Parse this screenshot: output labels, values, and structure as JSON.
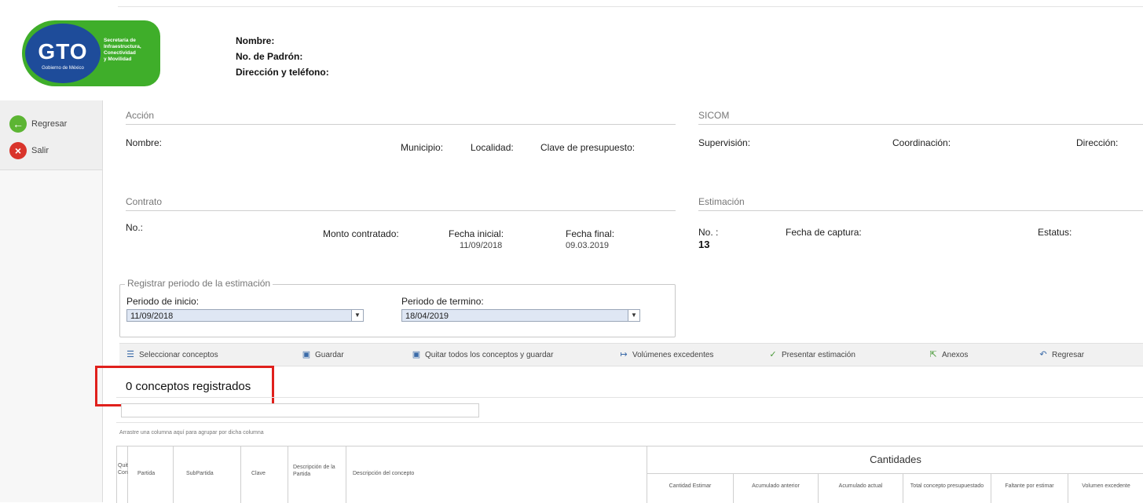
{
  "header": {
    "logo_text": "GTO",
    "logo_sub": "Gobierno de México",
    "logo_side": [
      "Secretaría de",
      "Infraestructura,",
      "Conectividad",
      "y Movilidad"
    ],
    "nombre_label": "Nombre:",
    "padron_label": "No. de Padrón:",
    "direccion_label": "Dirección y teléfono:"
  },
  "nav": {
    "regresar": "Regresar",
    "salir": "Salir"
  },
  "accion": {
    "title": "Acción",
    "nombre": "Nombre:",
    "municipio": "Municipio:",
    "localidad": "Localidad:",
    "clave": "Clave de presupuesto:"
  },
  "sicom": {
    "title": "SICOM",
    "supervision": "Supervisión:",
    "coordinacion": "Coordinación:",
    "direccion": "Dirección:"
  },
  "contrato": {
    "title": "Contrato",
    "no": "No.:",
    "monto": "Monto contratado:",
    "fecha_inicial_label": "Fecha inicial:",
    "fecha_inicial": "11/09/2018",
    "fecha_final_label": "Fecha final:",
    "fecha_final": "09.03.2019"
  },
  "estimacion": {
    "title": "Estimación",
    "no_label": "No. :",
    "no_value": "13",
    "fecha_captura": "Fecha de captura:",
    "estatus": "Estatus:"
  },
  "periodo": {
    "legend": "Registrar periodo de la estimación",
    "inicio_label": "Periodo de inicio:",
    "inicio_value": "11/09/2018",
    "termino_label": "Periodo de termino:",
    "termino_value": "18/04/2019"
  },
  "toolbar": {
    "seleccionar": "Seleccionar conceptos",
    "guardar": "Guardar",
    "quitar": "Quitar todos los conceptos y guardar",
    "volumenes": "Volúmenes excedentes",
    "presentar": "Presentar estimación",
    "anexos": "Anexos",
    "regresar": "Regresar"
  },
  "conceptos": {
    "count_text": "0 conceptos registrados",
    "group_hint": "Arrastre una columna aquí para agrupar por dicha columna"
  },
  "grid": {
    "col_quitar": "Quit. Conce.",
    "col_partida": "Partida",
    "col_subpartida": "SubPartida",
    "col_clave": "Clave",
    "col_desc_partida": "Descripción de la Partida",
    "col_desc_concepto": "Descripción del concepto",
    "cantidades": "Cantidades",
    "sub_cantidad_estimar": "Cantidad Estimar",
    "sub_acumulado_anterior": "Acumulado anterior",
    "sub_acumulado_actual": "Acumulado actual",
    "sub_total_concepto": "Total concepto presupuestado",
    "sub_faltante": "Faltante por estimar",
    "sub_volumen": "Volumen excedente"
  }
}
